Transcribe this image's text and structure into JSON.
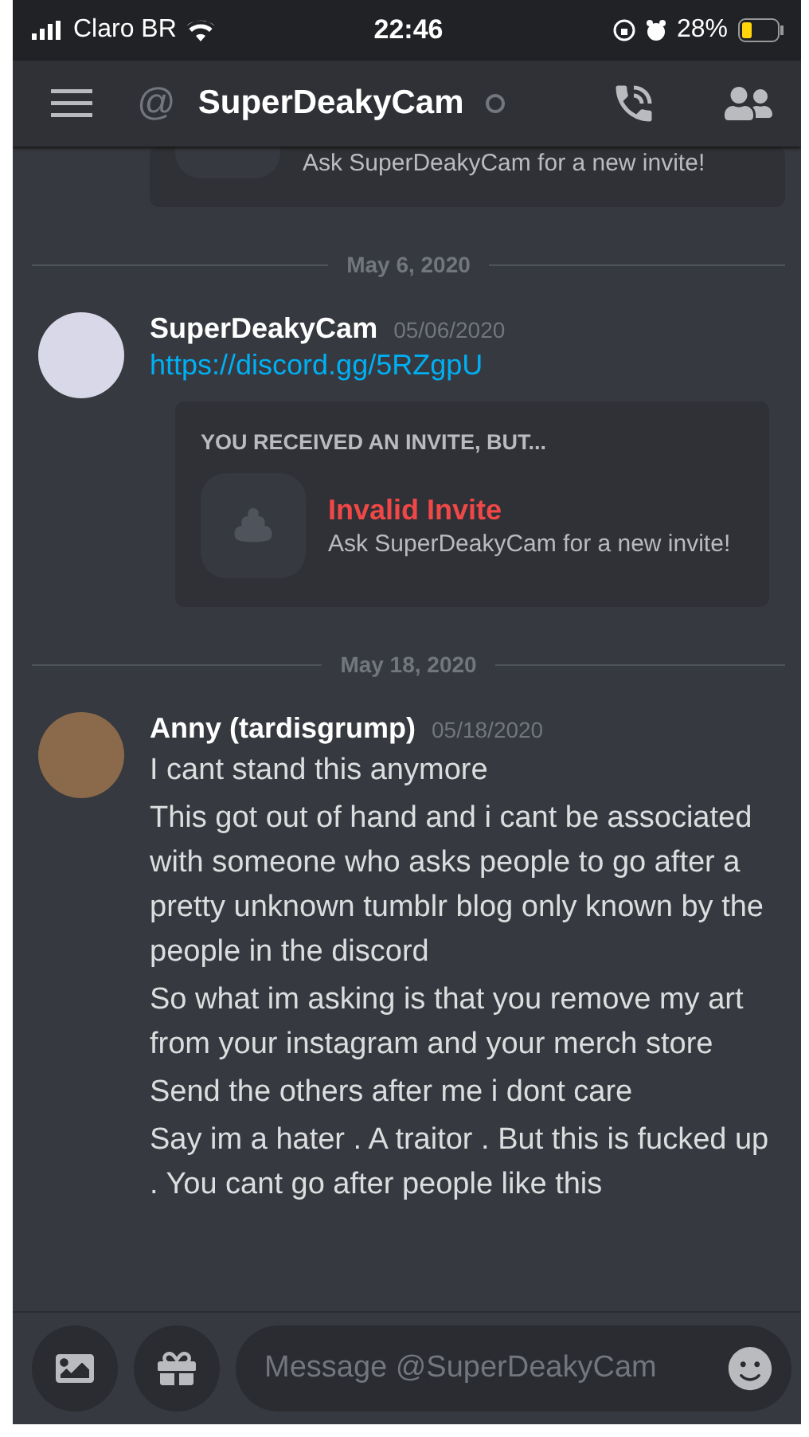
{
  "status_bar": {
    "carrier": "Claro BR",
    "time": "22:46",
    "battery": "28%"
  },
  "header": {
    "at_symbol": "@",
    "title": "SuperDeakyCam",
    "online": false
  },
  "previous_invite": {
    "subtitle": "Ask SuperDeakyCam for a new invite!"
  },
  "messages": [
    {
      "kind": "divider",
      "label": "May 6, 2020"
    },
    {
      "kind": "message",
      "author": "SuperDeakyCam",
      "timestamp": "05/06/2020",
      "link": "https://discord.gg/5RZgpU",
      "invite": {
        "heading": "YOU RECEIVED AN INVITE, BUT...",
        "title": "Invalid Invite",
        "subtitle": "Ask SuperDeakyCam for a new invite!"
      }
    },
    {
      "kind": "divider",
      "label": "May 18, 2020"
    },
    {
      "kind": "message",
      "author": "Anny (tardisgrump)",
      "timestamp": "05/18/2020",
      "lines": [
        "I cant stand this anymore",
        "This got out of hand and i cant be associated with someone who asks people to go after a pretty unknown tumblr blog only known by the people in the discord",
        "So what im asking is that you remove my art from your instagram and your merch store",
        "Send the others after me i dont care",
        "Say im a hater . A traitor . But this is fucked up . You cant go after people like this"
      ]
    }
  ],
  "composer": {
    "placeholder": "Message @SuperDeakyCam"
  }
}
